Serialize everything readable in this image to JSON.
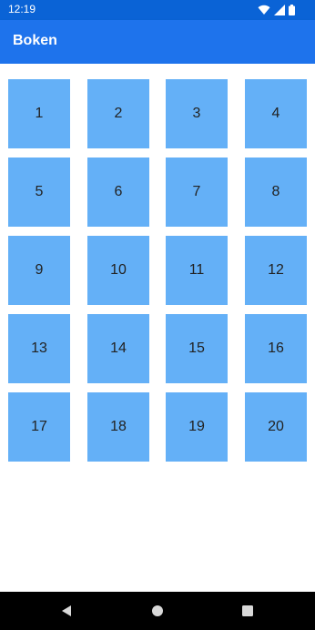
{
  "status_bar": {
    "time": "12:19",
    "icons": [
      "wifi-icon",
      "signal-icon",
      "battery-icon"
    ]
  },
  "app_bar": {
    "title": "Boken",
    "background": "#1e73ec"
  },
  "grid": {
    "tile_color": "#64b0f7",
    "items": [
      "1",
      "2",
      "3",
      "4",
      "5",
      "6",
      "7",
      "8",
      "9",
      "10",
      "11",
      "12",
      "13",
      "14",
      "15",
      "16",
      "17",
      "18",
      "19",
      "20"
    ]
  },
  "nav_bar": {
    "buttons": [
      "back-icon",
      "home-icon",
      "recents-icon"
    ]
  }
}
